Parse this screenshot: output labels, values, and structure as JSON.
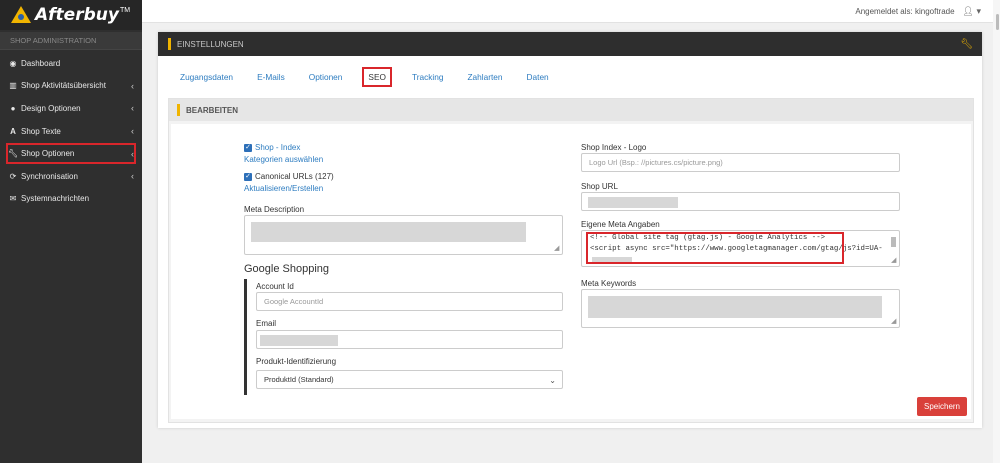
{
  "brand": {
    "name": "Afterbuy",
    "trademark": "TM"
  },
  "sidebar": {
    "section_label": "SHOP ADMINISTRATION",
    "items": [
      {
        "label": "Dashboard",
        "icon": "dashboard-icon",
        "has_chevron": false
      },
      {
        "label": "Shop Aktivitätsübersicht",
        "icon": "chart-icon",
        "has_chevron": true
      },
      {
        "label": "Design Optionen",
        "icon": "palette-icon",
        "has_chevron": true
      },
      {
        "label": "Shop Texte",
        "icon": "font-icon",
        "has_chevron": true
      },
      {
        "label": "Shop Optionen",
        "icon": "wrench-icon",
        "has_chevron": true,
        "active": true
      },
      {
        "label": "Synchronisation",
        "icon": "sync-icon",
        "has_chevron": true
      },
      {
        "label": "Systemnachrichten",
        "icon": "envelope-icon",
        "has_chevron": false
      }
    ],
    "chevron": "‹"
  },
  "topbar": {
    "logged_in_text": "Angemeldet als: kingoftrade",
    "user_icon": "user-icon"
  },
  "panel": {
    "title": "EINSTELLUNGEN",
    "tabs": [
      "Zugangsdaten",
      "E-Mails",
      "Optionen",
      "SEO",
      "Tracking",
      "Zahlarten",
      "Daten"
    ],
    "active_tab": "SEO",
    "section_title": "BEARBEITEN"
  },
  "form": {
    "shop_index_checkbox": "Shop - Index",
    "categories_link": "Kategorien auswählen",
    "canonical_checkbox": "Canonical URLs (127)",
    "refresh_link": "Aktualisieren/Erstellen",
    "meta_description_label": "Meta Description",
    "google_shopping_title": "Google Shopping",
    "account_id_label": "Account Id",
    "account_id_placeholder": "Google AccountId",
    "email_label": "Email",
    "product_id_label": "Produkt-Identifizierung",
    "product_id_value": "ProduktId (Standard)",
    "shop_index_logo_label": "Shop Index - Logo",
    "logo_placeholder": "Logo Url (Bsp.: //pictures.cs/picture.png)",
    "shop_url_label": "Shop URL",
    "meta_custom_label": "Eigene Meta Angaben",
    "meta_custom_lines": [
      "<!-- Global site tag (gtag.js) - Google Analytics -->",
      "<script async src=\"https://www.googletagmanager.com/gtag/js?id=UA-"
    ],
    "meta_keywords_label": "Meta Keywords",
    "save_button": "Speichern"
  },
  "colors": {
    "accent": "#f0b400",
    "link": "#2d7cc0",
    "highlight": "#d9262b",
    "save": "#d9403a"
  }
}
